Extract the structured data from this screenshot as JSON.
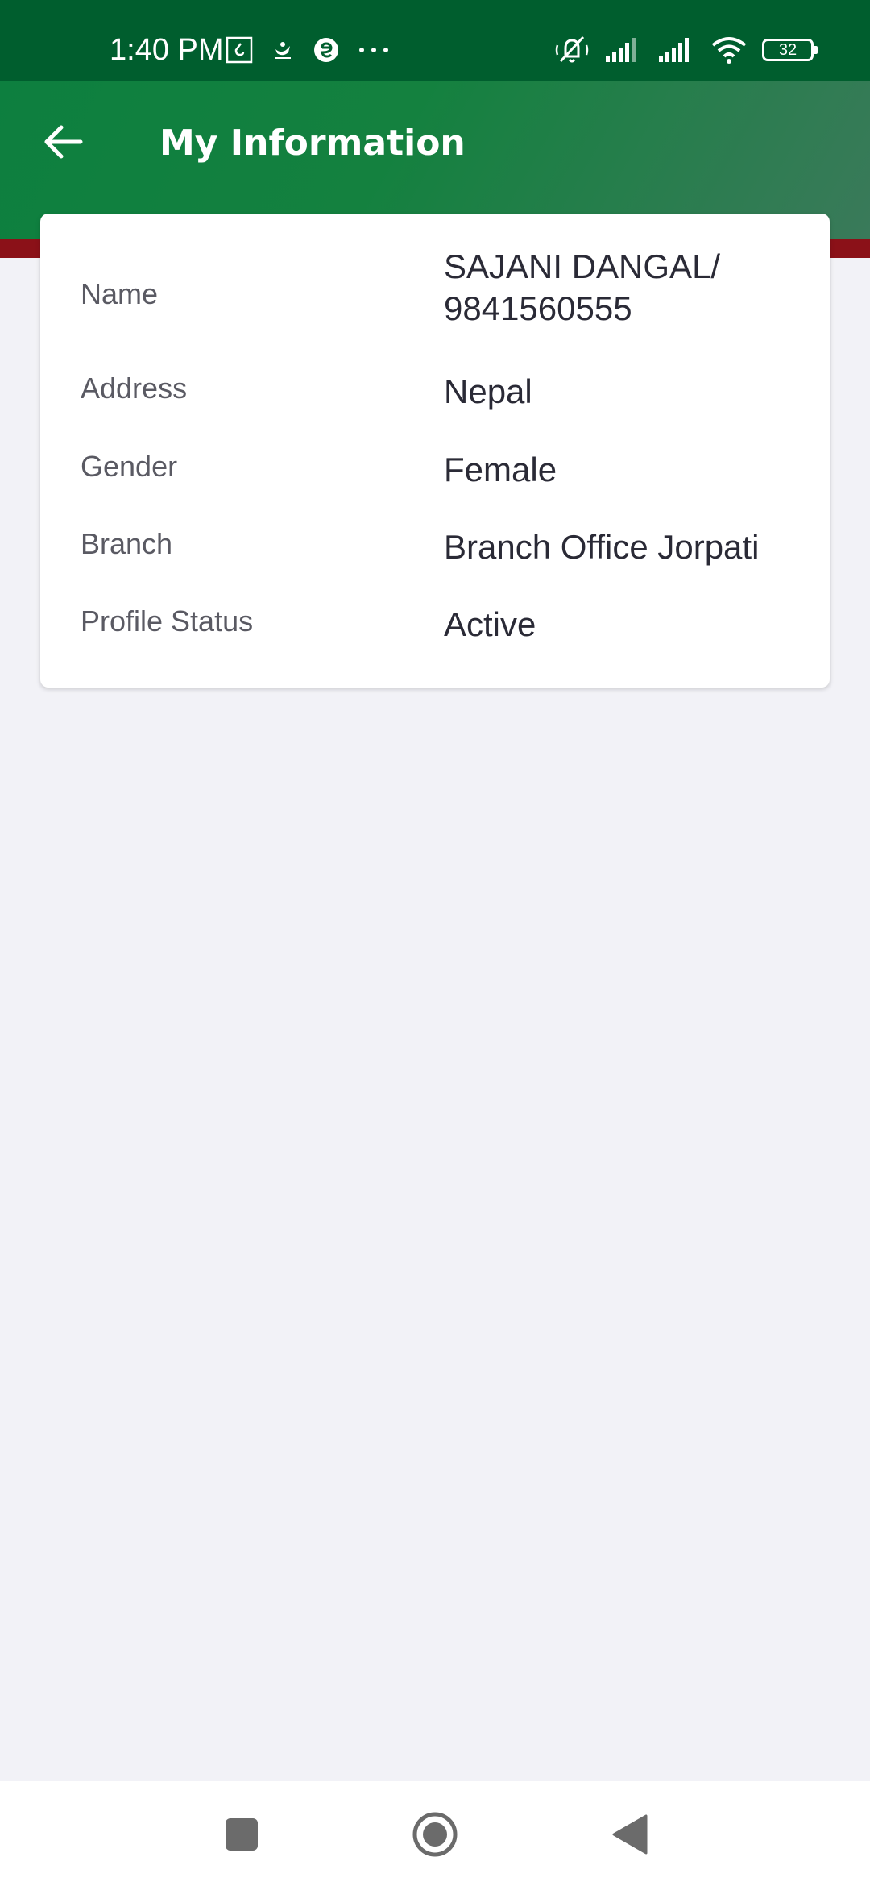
{
  "status_bar": {
    "time": "1:40 PM",
    "battery": "32",
    "icons": [
      "message-icon",
      "app-logo-icon",
      "e-app-icon",
      "more-dots-icon",
      "mute-icon",
      "signal-icon",
      "signal-icon",
      "wifi-icon",
      "battery-icon"
    ]
  },
  "header": {
    "title": "My Information",
    "back_icon": "arrow-left-icon",
    "colors": {
      "primary": "#0d7f3f",
      "accent_stripe": "#8b1118"
    }
  },
  "info": {
    "rows": [
      {
        "label": "Name",
        "value": "SAJANI DANGAL/ 9841560555"
      },
      {
        "label": "Address",
        "value": "Nepal"
      },
      {
        "label": "Gender",
        "value": "Female"
      },
      {
        "label": "Branch",
        "value": "Branch Office Jorpati"
      },
      {
        "label": "Profile Status",
        "value": "Active"
      }
    ]
  },
  "nav_bar": {
    "icons": [
      "recent-apps-icon",
      "home-icon",
      "back-icon"
    ]
  }
}
